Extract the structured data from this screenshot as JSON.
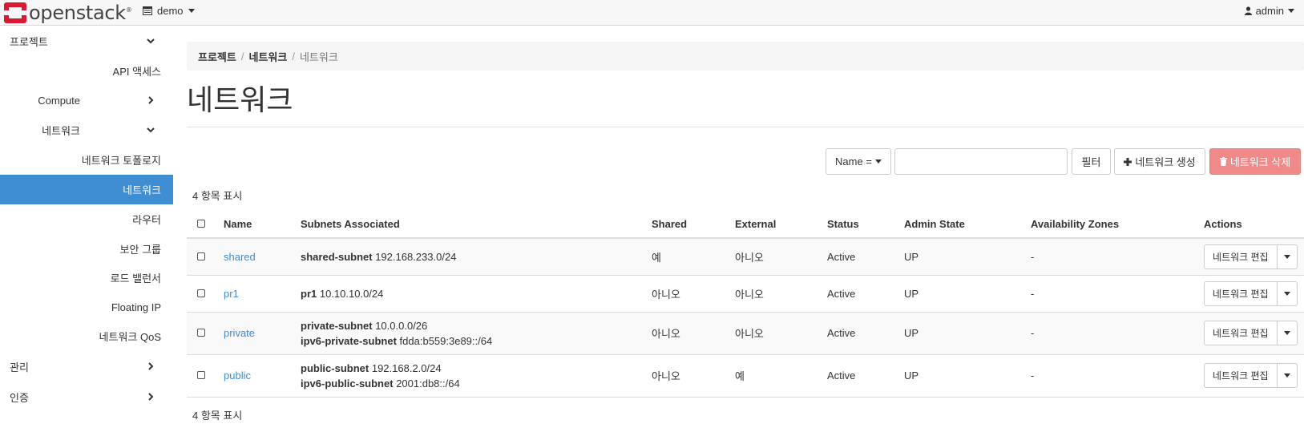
{
  "navbar": {
    "logo_text": "openstack",
    "logo_mark": "®",
    "project": "demo",
    "user": "admin"
  },
  "sidebar": {
    "items": [
      {
        "label": "프로젝트",
        "level": 0,
        "chevron": "down"
      },
      {
        "label": "API 액세스",
        "level": 2
      },
      {
        "label": "Compute",
        "level": 1,
        "chevron": "right"
      },
      {
        "label": "네트워크",
        "level": 1,
        "chevron": "down"
      },
      {
        "label": "네트워크 토폴로지",
        "level": 2
      },
      {
        "label": "네트워크",
        "level": 2,
        "active": true
      },
      {
        "label": "라우터",
        "level": 2
      },
      {
        "label": "보안 그룹",
        "level": 2
      },
      {
        "label": "로드 밸런서",
        "level": 2
      },
      {
        "label": "Floating IP",
        "level": 2
      },
      {
        "label": "네트워크 QoS",
        "level": 2
      },
      {
        "label": "관리",
        "level": 0,
        "chevron": "right"
      },
      {
        "label": "인증",
        "level": 0,
        "chevron": "right"
      }
    ]
  },
  "breadcrumb": {
    "items": [
      "프로젝트",
      "네트워크"
    ],
    "current": "네트워크"
  },
  "page": {
    "title": "네트워크"
  },
  "toolbar": {
    "filter_select": "Name =",
    "filter_value": "",
    "filter_button": "필터",
    "create_button": "네트워크 생성",
    "delete_button": "네트워크 삭제"
  },
  "table": {
    "count_top": "4 항목 표시",
    "count_bottom": "4 항목 표시",
    "headers": {
      "name": "Name",
      "subnets": "Subnets Associated",
      "shared": "Shared",
      "external": "External",
      "status": "Status",
      "admin_state": "Admin State",
      "zones": "Availability Zones",
      "actions": "Actions"
    },
    "rows": [
      {
        "name": "shared",
        "subnets": [
          {
            "name": "shared-subnet",
            "cidr": "192.168.233.0/24"
          }
        ],
        "shared": "예",
        "external": "아니오",
        "status": "Active",
        "admin_state": "UP",
        "zones": "-",
        "action": "네트워크 편집"
      },
      {
        "name": "pr1",
        "subnets": [
          {
            "name": "pr1",
            "cidr": "10.10.10.0/24"
          }
        ],
        "shared": "아니오",
        "external": "아니오",
        "status": "Active",
        "admin_state": "UP",
        "zones": "-",
        "action": "네트워크 편집"
      },
      {
        "name": "private",
        "subnets": [
          {
            "name": "private-subnet",
            "cidr": "10.0.0.0/26"
          },
          {
            "name": "ipv6-private-subnet",
            "cidr": "fdda:b559:3e89::/64"
          }
        ],
        "shared": "아니오",
        "external": "아니오",
        "status": "Active",
        "admin_state": "UP",
        "zones": "-",
        "action": "네트워크 편집"
      },
      {
        "name": "public",
        "subnets": [
          {
            "name": "public-subnet",
            "cidr": "192.168.2.0/24"
          },
          {
            "name": "ipv6-public-subnet",
            "cidr": "2001:db8::/64"
          }
        ],
        "shared": "아니오",
        "external": "예",
        "status": "Active",
        "admin_state": "UP",
        "zones": "-",
        "action": "네트워크 편집"
      }
    ]
  },
  "colors": {
    "accent": "#3f8dd2",
    "danger": "#f08a88"
  }
}
